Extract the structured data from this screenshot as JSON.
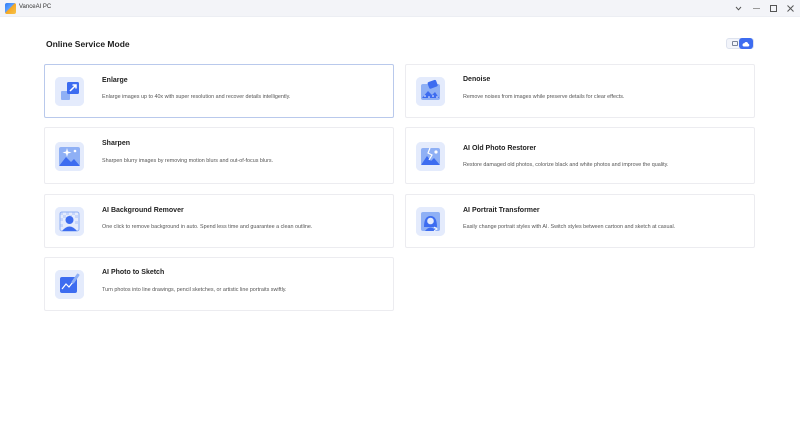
{
  "window": {
    "title": "VanceAI PC",
    "controls": [
      "chevron-down",
      "minimize",
      "maximize",
      "close"
    ]
  },
  "page": {
    "title": "Online Service Mode",
    "mode_toggle": {
      "selected": "cloud"
    }
  },
  "cards": [
    {
      "id": "enlarge",
      "title": "Enlarge",
      "desc": "Enlarge images up to 40x with super resolution and recover details intelligently.",
      "active": true,
      "icon": "enlarge-icon"
    },
    {
      "id": "denoise",
      "title": "Denoise",
      "desc": "Remove noises from images while preserve details for clear effects.",
      "active": false,
      "icon": "denoise-icon"
    },
    {
      "id": "sharpen",
      "title": "Sharpen",
      "desc": "Sharpen blurry images by removing motion blurs and out-of-focus blurs.",
      "active": false,
      "icon": "sharpen-icon"
    },
    {
      "id": "old-photo-restorer",
      "title": "AI Old Photo Restorer",
      "desc": "Restore damaged old photos, colorize black and white photos and improve the quality.",
      "active": false,
      "icon": "photo-restorer-icon"
    },
    {
      "id": "background-remover",
      "title": "AI Background Remover",
      "desc": "One click to remove background in auto. Spend less time and guarantee a clean outline.",
      "active": false,
      "icon": "background-remover-icon"
    },
    {
      "id": "portrait-transformer",
      "title": "AI Portrait Transformer",
      "desc": "Easily change portrait styles with AI. Switch styles between cartoon and sketch at casual.",
      "active": false,
      "icon": "portrait-transformer-icon"
    },
    {
      "id": "photo-to-sketch",
      "title": "AI Photo to Sketch",
      "desc": "Turn photos into line drawings, pencil sketches, or artistic line portraits swiftly.",
      "active": false,
      "icon": "photo-to-sketch-icon"
    }
  ]
}
